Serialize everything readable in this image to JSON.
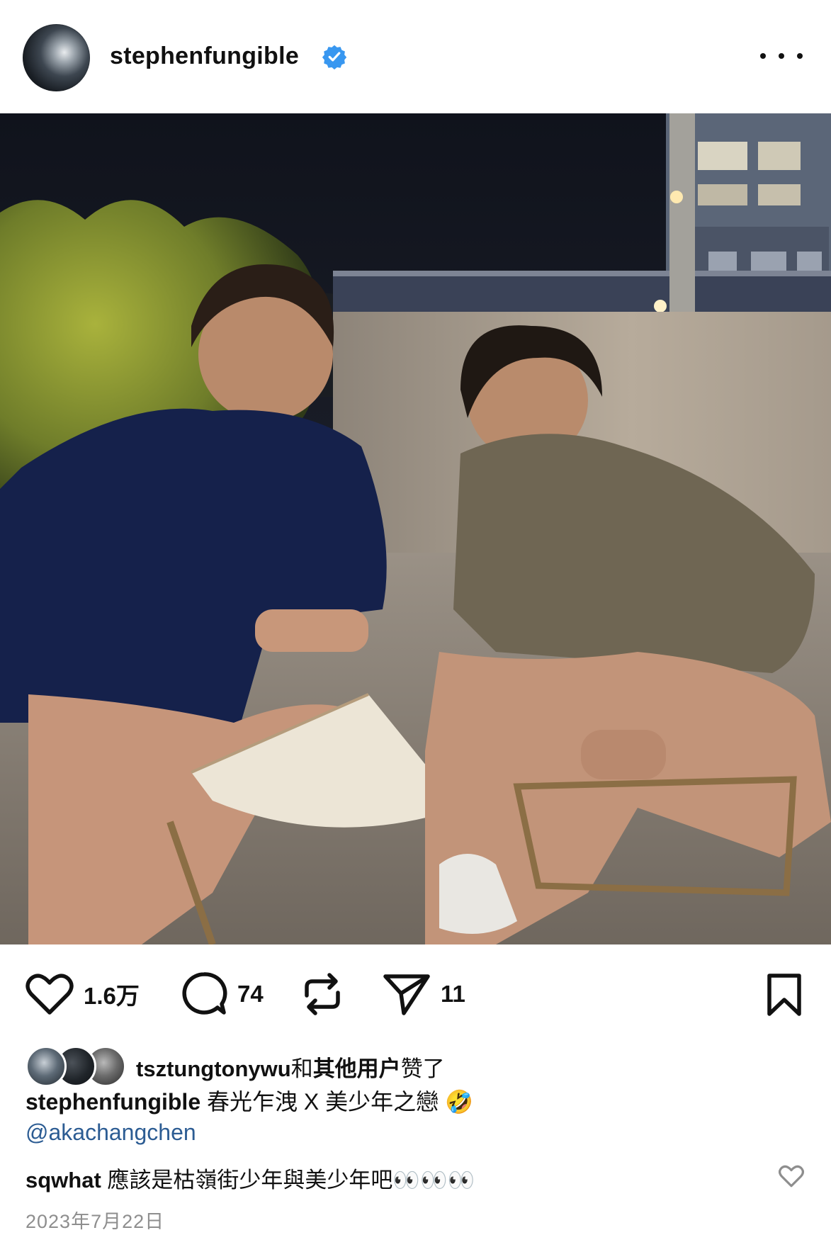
{
  "header": {
    "username": "stephenfungible",
    "verified_icon": "verified-badge-icon",
    "more_icon": "more-horizontal-icon"
  },
  "post": {
    "image_desc_icon": "photo"
  },
  "actions": {
    "like_count": "1.6万",
    "comment_count": "74",
    "share_count": "11"
  },
  "likes": {
    "first_user": "tsztungtonywu",
    "and": "和",
    "others": "其他用户",
    "suffix": "赞了"
  },
  "caption": {
    "username": "stephenfungible",
    "text": "春光乍洩 X 美少年之戀 🤣",
    "mention": "@akachangchen"
  },
  "comment": {
    "username": "sqwhat",
    "text": "應該是枯嶺街少年與美少年吧👀👀👀"
  },
  "date": "2023年7月22日",
  "colors": {
    "verified": "#3897f0",
    "mention": "#2c5c93",
    "muted": "#8e8e8e"
  }
}
